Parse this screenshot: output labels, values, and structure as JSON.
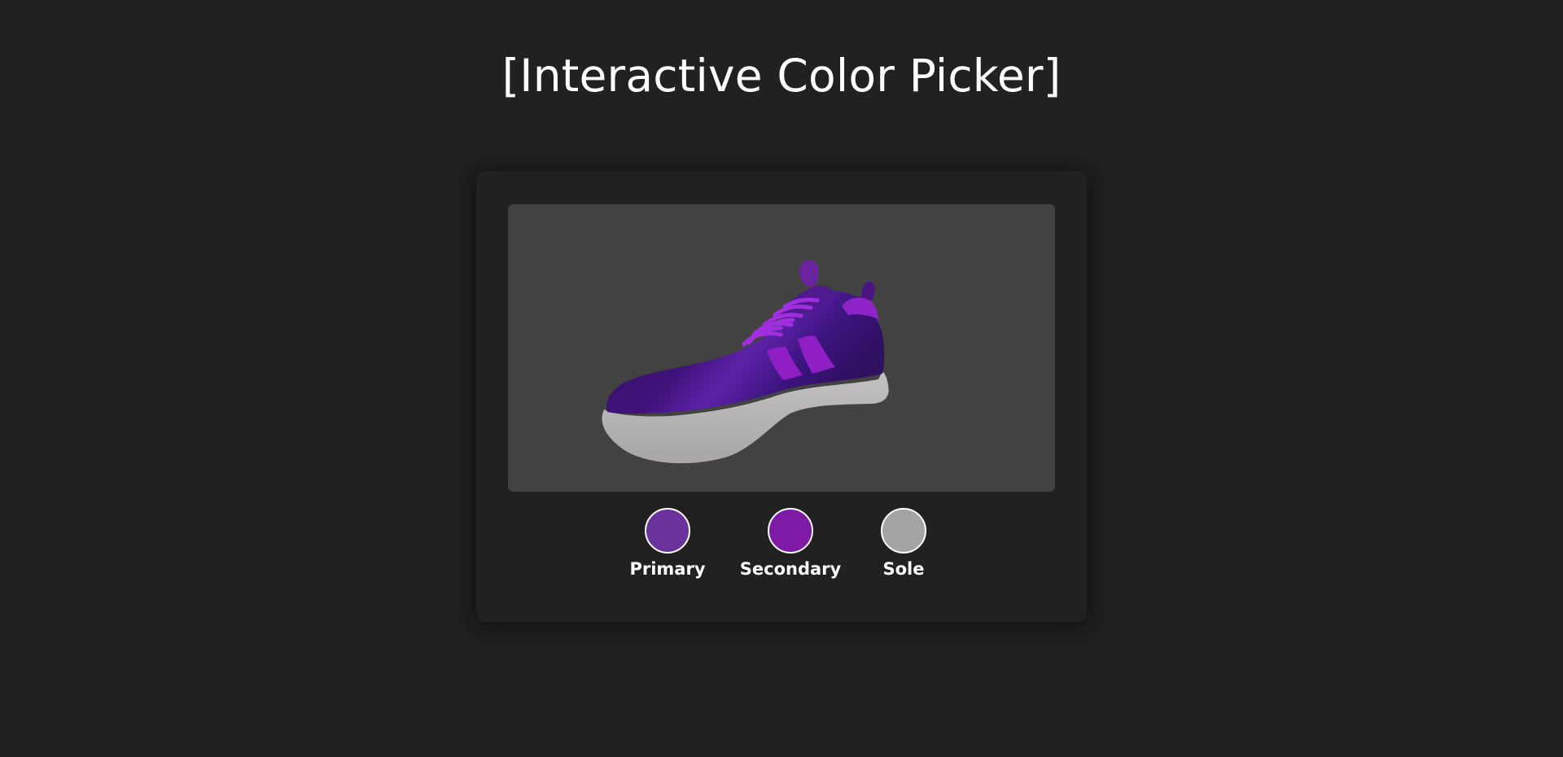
{
  "page": {
    "title": "[Interactive Color Picker]"
  },
  "colors": {
    "background": "#212121",
    "viewer_background": "#424242",
    "primary": "#6a329a",
    "secondary": "#7f1aa6",
    "sole": "#a6a3a3"
  },
  "viewer": {
    "model": "sneaker"
  },
  "swatches": [
    {
      "label": "Primary",
      "color": "#6a329a"
    },
    {
      "label": "Secondary",
      "color": "#7f1aa6"
    },
    {
      "label": "Sole",
      "color": "#a6a3a3"
    }
  ]
}
